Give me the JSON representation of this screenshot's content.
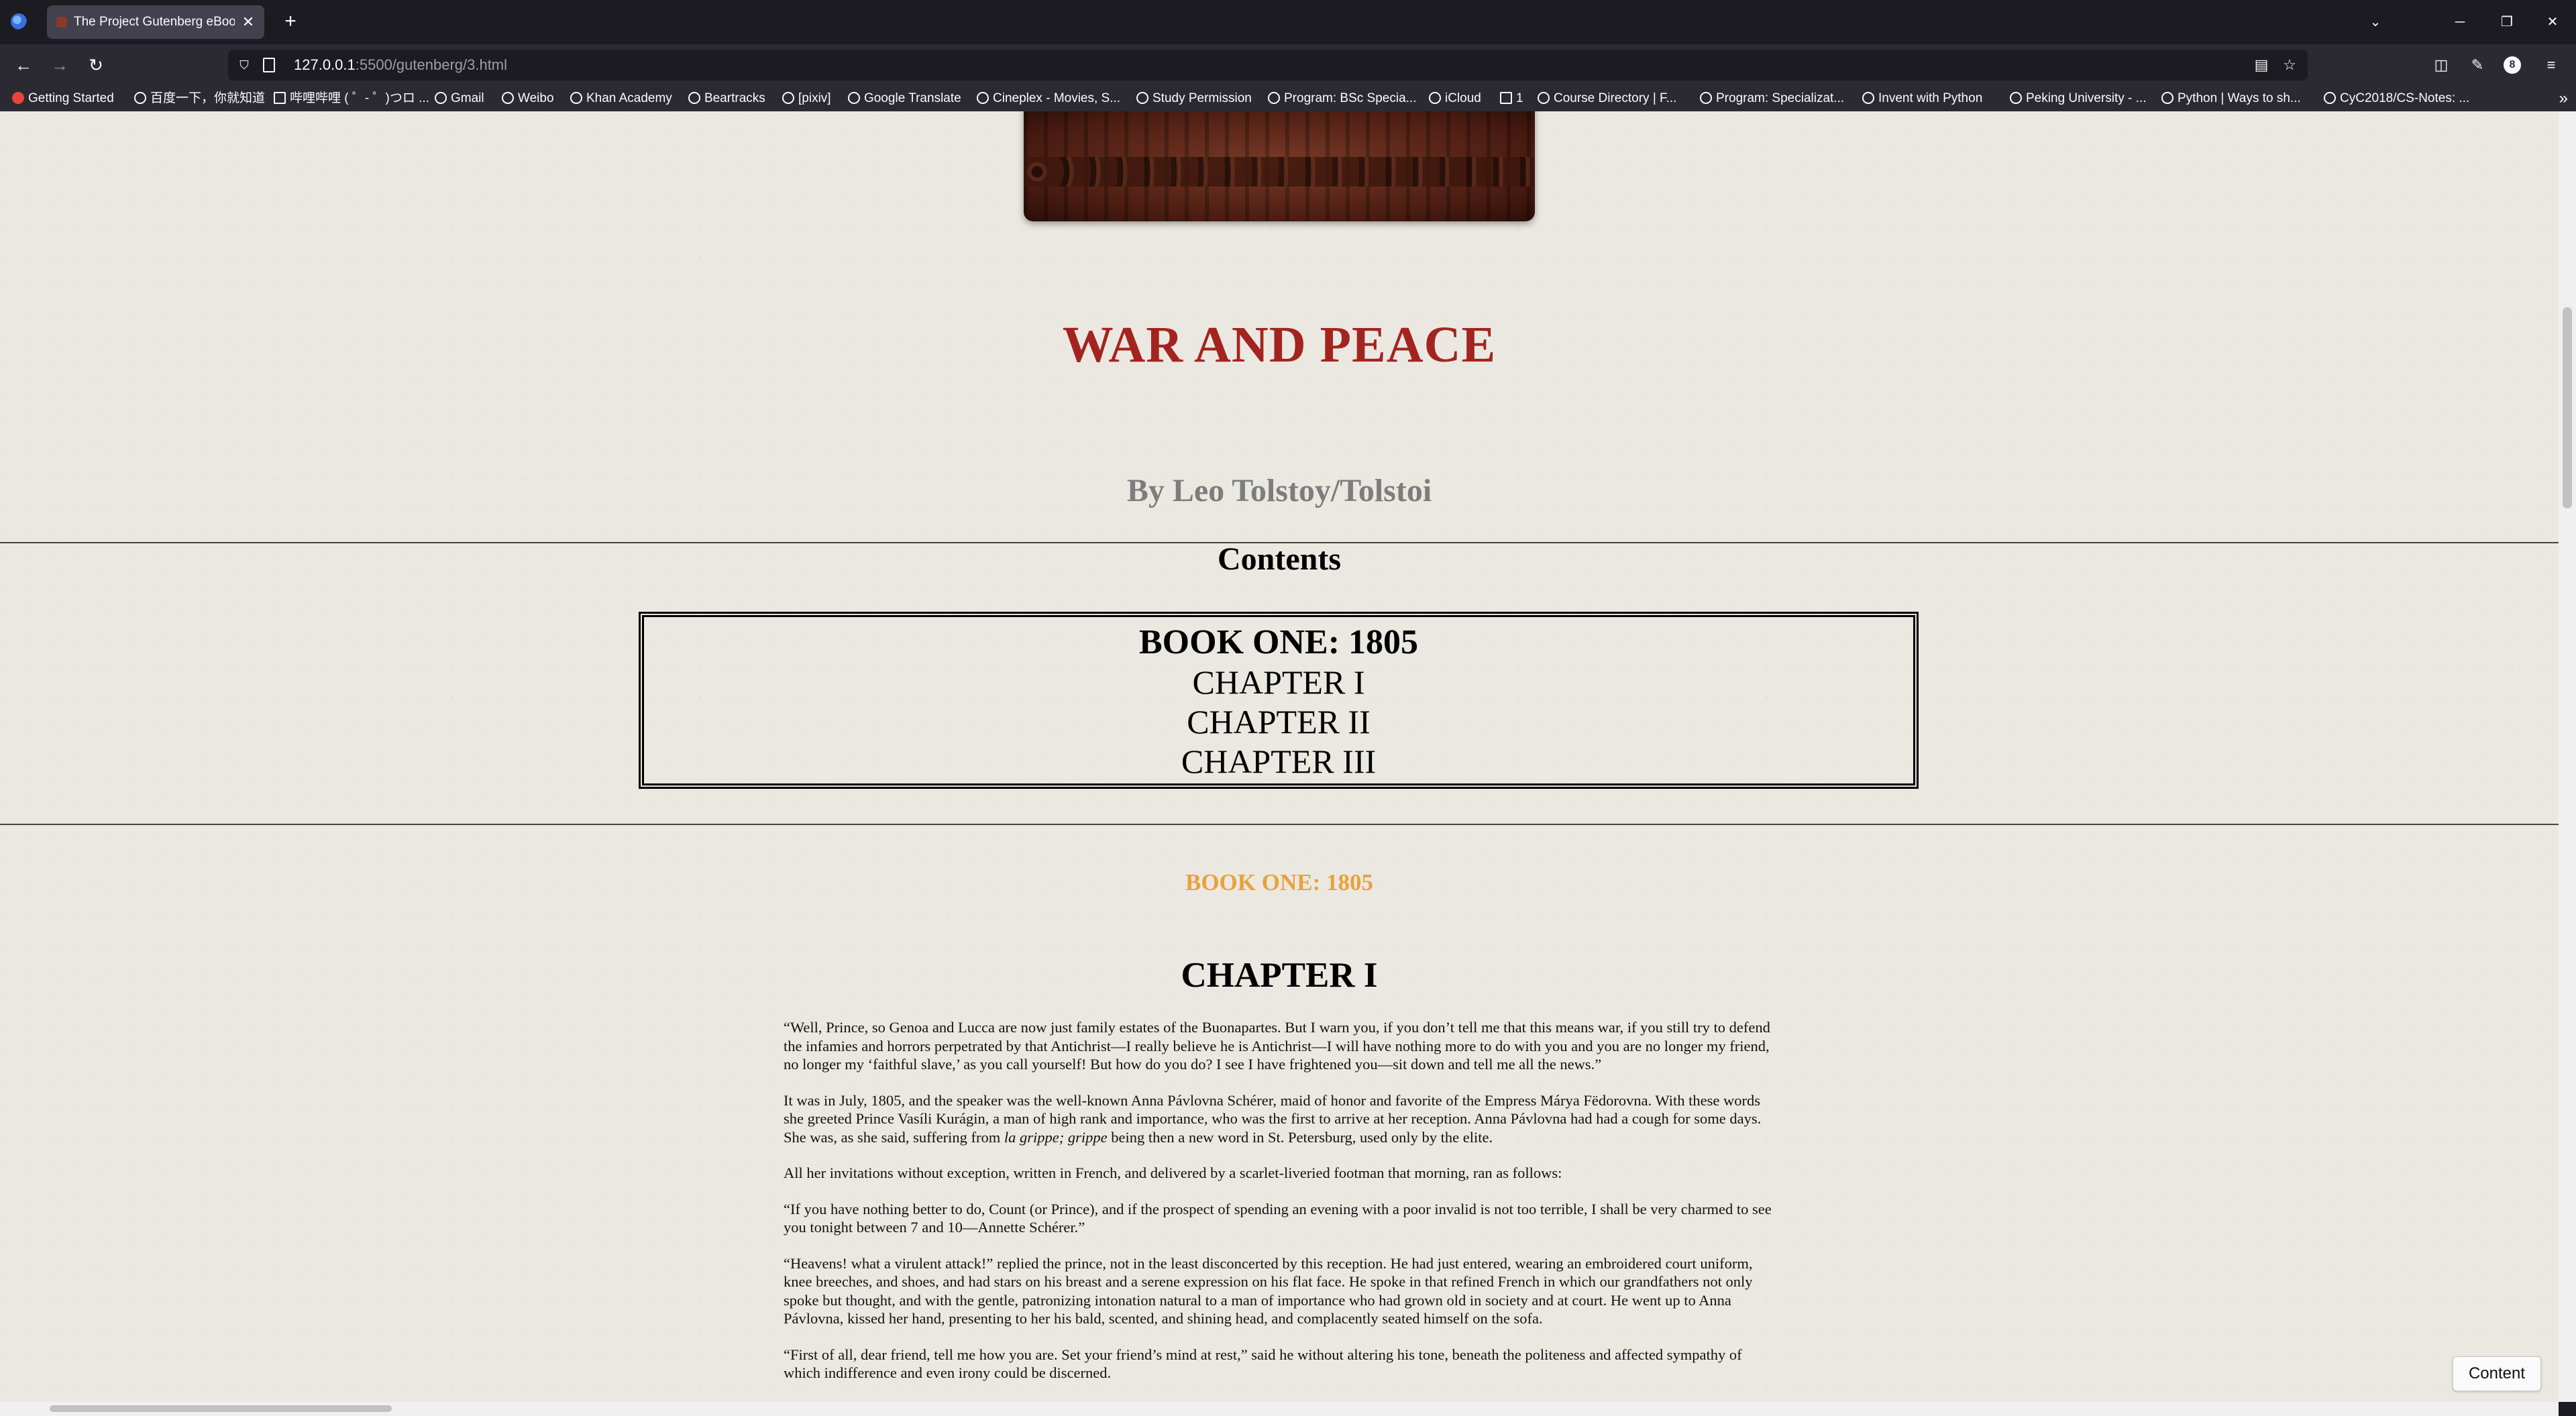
{
  "browser": {
    "tab_title": "The Project Gutenberg eBook",
    "tab_close": "✕",
    "new_tab": "+",
    "url_host": "127.0.0.1",
    "url_rest": ":5500/gutenberg/3.html",
    "window_controls": {
      "minimize": "─",
      "restore": "❐",
      "close": "✕"
    },
    "tab_list": "⌄",
    "nav": {
      "back": "←",
      "forward": "→",
      "reload": "↻"
    },
    "icons": {
      "reader": "▤",
      "star": "☆",
      "pocket": "◫",
      "extensions": "✎",
      "menu": "≡",
      "profile": "8"
    }
  },
  "bookmarks": [
    {
      "label": "Getting Started",
      "icon": "firefox-icon"
    },
    {
      "label": "百度一下，你就知道",
      "icon": "baidu-icon"
    },
    {
      "label": "哔哩哔哩 ( ゜- ゜)つロ ...",
      "icon": "bilibili-icon"
    },
    {
      "label": "Gmail",
      "icon": "globe-icon"
    },
    {
      "label": "Weibo",
      "icon": "globe-icon"
    },
    {
      "label": "Khan Academy",
      "icon": "globe-icon"
    },
    {
      "label": "Beartracks",
      "icon": "globe-icon"
    },
    {
      "label": "[pixiv]",
      "icon": "globe-icon"
    },
    {
      "label": "Google Translate",
      "icon": "globe-icon"
    },
    {
      "label": "Cineplex - Movies, S...",
      "icon": "globe-icon"
    },
    {
      "label": "Study Permission",
      "icon": "globe-icon"
    },
    {
      "label": "Program: BSc Specia...",
      "icon": "globe-icon"
    },
    {
      "label": "iCloud",
      "icon": "globe-icon"
    },
    {
      "label": "1",
      "icon": "folder-icon"
    },
    {
      "label": "Course Directory | F...",
      "icon": "globe-icon"
    },
    {
      "label": "Program: Specializat...",
      "icon": "globe-icon"
    },
    {
      "label": "Invent with Python",
      "icon": "globe-icon"
    },
    {
      "label": "Peking University - ...",
      "icon": "globe-icon"
    },
    {
      "label": "Python | Ways to sh...",
      "icon": "globe-icon"
    },
    {
      "label": "CyC2018/CS-Notes: ...",
      "icon": "globe-icon"
    }
  ],
  "bookmarks_overflow": "»",
  "page": {
    "title": "WAR AND PEACE",
    "author": "By Leo Tolstoy/Tolstoi",
    "contents_heading": "Contents",
    "toc": {
      "book": "BOOK ONE: 1805",
      "chapters": [
        "CHAPTER I",
        "CHAPTER II",
        "CHAPTER III"
      ]
    },
    "book_heading": "BOOK ONE: 1805",
    "chapter_heading": "CHAPTER I",
    "paragraphs": [
      "“Well, Prince, so Genoa and Lucca are now just family estates of the Buonapartes. But I warn you, if you don’t tell me that this means war, if you still try to defend the infamies and horrors perpetrated by that Antichrist—I really believe he is Antichrist—I will have nothing more to do with you and you are no longer my friend, no longer my ‘faithful slave,’ as you call yourself! But how do you do? I see I have frightened you—sit down and tell me all the news.”",
      "It was in July, 1805, and the speaker was the well-known Anna Pávlovna Schérer, maid of honor and favorite of the Empress Márya Fëdorovna. With these words she greeted Prince Vasíli Kurágin, a man of high rank and importance, who was the first to arrive at her reception. Anna Pávlovna had had a cough for some days. She was, as she said, suffering from ",
      "All her invitations without exception, written in French, and delivered by a scarlet-liveried footman that morning, ran as follows:",
      "“If you have nothing better to do, Count (or Prince), and if the prospect of spending an evening with a poor invalid is not too terrible, I shall be very charmed to see you tonight between 7 and 10—Annette Schérer.”",
      "“Heavens! what a virulent attack!” replied the prince, not in the least disconcerted by this reception. He had just entered, wearing an embroidered court uniform, knee breeches, and shoes, and had stars on his breast and a serene expression on his flat face. He spoke in that refined French in which our grandfathers not only spoke but thought, and with the gentle, patronizing intonation natural to a man of importance who had grown old in society and at court. He went up to Anna Pávlovna, kissed her hand, presenting to her his bald, scented, and shining head, and complacently seated himself on the sofa.",
      "“First of all, dear friend, tell me how you are. Set your friend’s mind at rest,” said he without altering his tone, beneath the politeness and affected sympathy of which indifference and even irony could be discerned."
    ],
    "p2_italic": "la grippe; grippe",
    "p2_tail": " being then a new word in St. Petersburg, used only by the elite.",
    "float_button": "Content"
  }
}
